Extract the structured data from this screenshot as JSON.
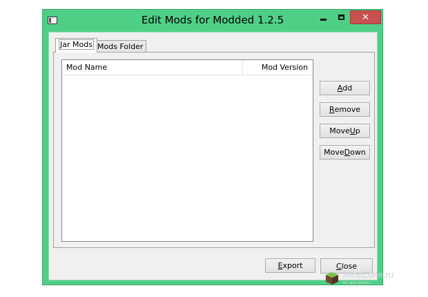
{
  "window": {
    "title": "Edit Mods for Modded 1.2.5",
    "close_glyph": "✕"
  },
  "tabs": [
    {
      "label": "Jar Mods",
      "active": true
    },
    {
      "label": "Mods Folder",
      "active": false
    }
  ],
  "list": {
    "columns": [
      "Mod Name",
      "Mod Version"
    ],
    "rows": []
  },
  "side_buttons": {
    "add": {
      "pre": "",
      "key": "A",
      "post": "dd"
    },
    "remove": {
      "pre": "",
      "key": "R",
      "post": "emove"
    },
    "move_up": {
      "pre": "Move ",
      "key": "U",
      "post": "p"
    },
    "move_down": {
      "pre": "Move ",
      "key": "D",
      "post": "own"
    }
  },
  "footer_buttons": {
    "export": {
      "pre": "",
      "key": "E",
      "post": "xport"
    },
    "close": {
      "pre": "",
      "key": "C",
      "post": "lose"
    }
  },
  "watermark": {
    "text": "MineZone.ru",
    "subtext": "for ace servers"
  },
  "colors": {
    "frame": "#4fcf86",
    "close_button": "#c75050",
    "client": "#f0f0f0"
  }
}
